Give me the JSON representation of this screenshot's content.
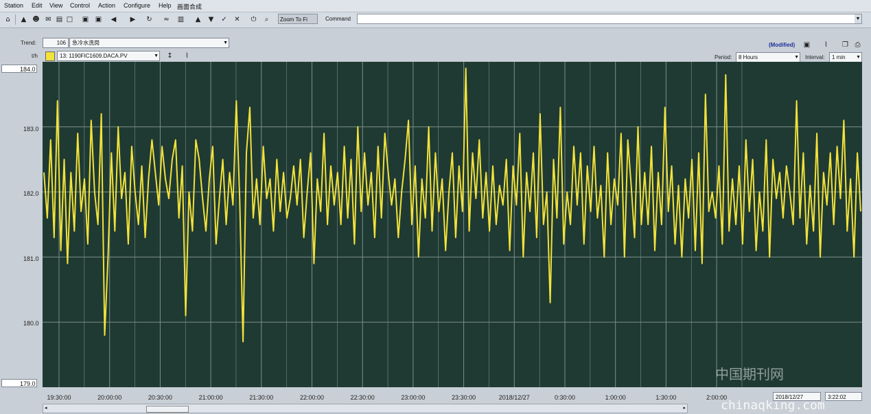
{
  "menu": [
    "Station",
    "Edit",
    "View",
    "Control",
    "Action",
    "Configure",
    "Help",
    "画面合成"
  ],
  "toolbar": {
    "zoom_label": "Zoom To Fi",
    "command_label": "Command",
    "command_value": ""
  },
  "trend": {
    "label": "Trend:",
    "number": "106",
    "name": "急冷水洗岗"
  },
  "pen": {
    "label": "t/h",
    "tag": "13: 1190FIC1609.DACA.PV",
    "color": "#f2e23a"
  },
  "status": {
    "modified": "(Modified)"
  },
  "period": {
    "label": "Period:",
    "value": "8 Hours"
  },
  "interval": {
    "label": "Interval:",
    "value": "1 min"
  },
  "y_axis": {
    "max_box": "184.0",
    "min_box": "179.0",
    "ticks": [
      "183.0",
      "182.0",
      "181.0",
      "180.0"
    ]
  },
  "footer": {
    "date": "2018/12/27",
    "time": "3:22:02"
  },
  "watermark": {
    "cn": "中国期刊网",
    "en": "chinaqking.com"
  },
  "colors": {
    "plot_bg": "#1f3a33",
    "grid": "#7d8f8a",
    "line": "#f2e23a"
  },
  "chart_data": {
    "type": "line",
    "title": "",
    "xlabel": "",
    "ylabel": "t/h",
    "ylim": [
      179.0,
      184.0
    ],
    "grid": true,
    "x_ticks": [
      "19:30:00",
      "20:00:00",
      "20:30:00",
      "21:00:00",
      "21:30:00",
      "22:00:00",
      "22:30:00",
      "23:00:00",
      "23:30:00",
      "2018/12/27",
      "0:30:00",
      "1:00:00",
      "1:30:00",
      "2:00:00"
    ],
    "x_range": [
      "2018/12/26 19:25",
      "2018/12/27 03:22"
    ],
    "series": [
      {
        "name": "",
        "values": [
          182.3,
          181.6,
          182.8,
          181.3,
          183.4,
          181.1,
          182.5,
          180.9,
          182.3,
          181.4,
          182.9,
          181.7,
          182.2,
          181.2,
          183.1,
          182.0,
          181.5,
          183.2,
          179.8,
          181.0,
          182.6,
          181.4,
          183.0,
          181.9,
          182.3,
          181.2,
          182.7,
          182.0,
          181.5,
          182.4,
          181.3,
          182.2,
          182.8,
          182.3,
          181.8,
          182.7,
          182.2,
          181.9,
          182.5,
          182.8,
          181.6,
          182.4,
          180.1,
          182.0,
          181.4,
          182.8,
          182.5,
          181.9,
          181.4,
          182.2,
          182.7,
          181.2,
          181.9,
          182.5,
          181.5,
          182.3,
          181.8,
          183.4,
          181.9,
          179.7,
          182.6,
          183.3,
          181.6,
          182.2,
          181.5,
          182.7,
          181.9,
          182.2,
          181.4,
          182.5,
          181.7,
          182.3,
          181.6,
          181.9,
          182.4,
          181.8,
          182.5,
          181.3,
          182.0,
          182.6,
          180.9,
          182.2,
          181.7,
          182.9,
          181.5,
          182.4,
          181.8,
          182.3,
          181.5,
          182.7,
          181.6,
          182.5,
          181.2,
          183.0,
          181.7,
          182.6,
          181.8,
          182.3,
          181.3,
          182.7,
          181.6,
          182.9,
          182.3,
          181.8,
          182.2,
          181.3,
          182.0,
          182.5,
          183.1,
          181.5,
          182.4,
          181.0,
          182.2,
          181.6,
          183.0,
          181.4,
          182.6,
          181.7,
          182.2,
          181.1,
          182.0,
          182.6,
          181.3,
          182.4,
          181.7,
          183.9,
          181.4,
          182.6,
          181.9,
          182.8,
          181.6,
          182.3,
          181.4,
          182.4,
          181.5,
          182.1,
          181.8,
          182.5,
          181.1,
          182.4,
          181.8,
          182.9,
          181.0,
          182.3,
          181.7,
          182.6,
          181.3,
          183.2,
          181.5,
          182.0,
          180.3,
          182.5,
          181.6,
          183.3,
          181.2,
          182.0,
          181.5,
          182.7,
          181.8,
          182.6,
          181.2,
          182.4,
          181.7,
          182.7,
          181.6,
          182.1,
          181.0,
          182.6,
          181.5,
          182.2,
          181.8,
          182.9,
          181.0,
          182.8,
          182.1,
          181.3,
          183.0,
          181.5,
          182.3,
          181.5,
          182.7,
          181.1,
          182.3,
          181.5,
          183.3,
          181.7,
          182.4,
          181.2,
          182.1,
          181.0,
          182.2,
          181.6,
          182.5,
          181.1,
          182.6,
          180.9,
          183.5,
          181.7,
          182.0,
          181.6,
          182.4,
          181.2,
          183.8,
          181.4,
          182.2,
          181.5,
          182.4,
          181.2,
          182.8,
          181.7,
          182.5,
          181.1,
          182.0,
          181.4,
          182.8,
          181.0,
          182.5,
          181.9,
          182.3,
          181.6,
          182.4,
          182.0,
          181.5,
          183.4,
          181.6,
          182.6,
          181.2,
          182.1,
          181.4,
          182.9,
          181.0,
          182.3,
          181.8,
          182.6,
          181.5,
          182.7,
          181.9,
          183.1,
          181.4,
          182.2,
          181.0,
          182.6,
          181.7
        ]
      }
    ]
  }
}
